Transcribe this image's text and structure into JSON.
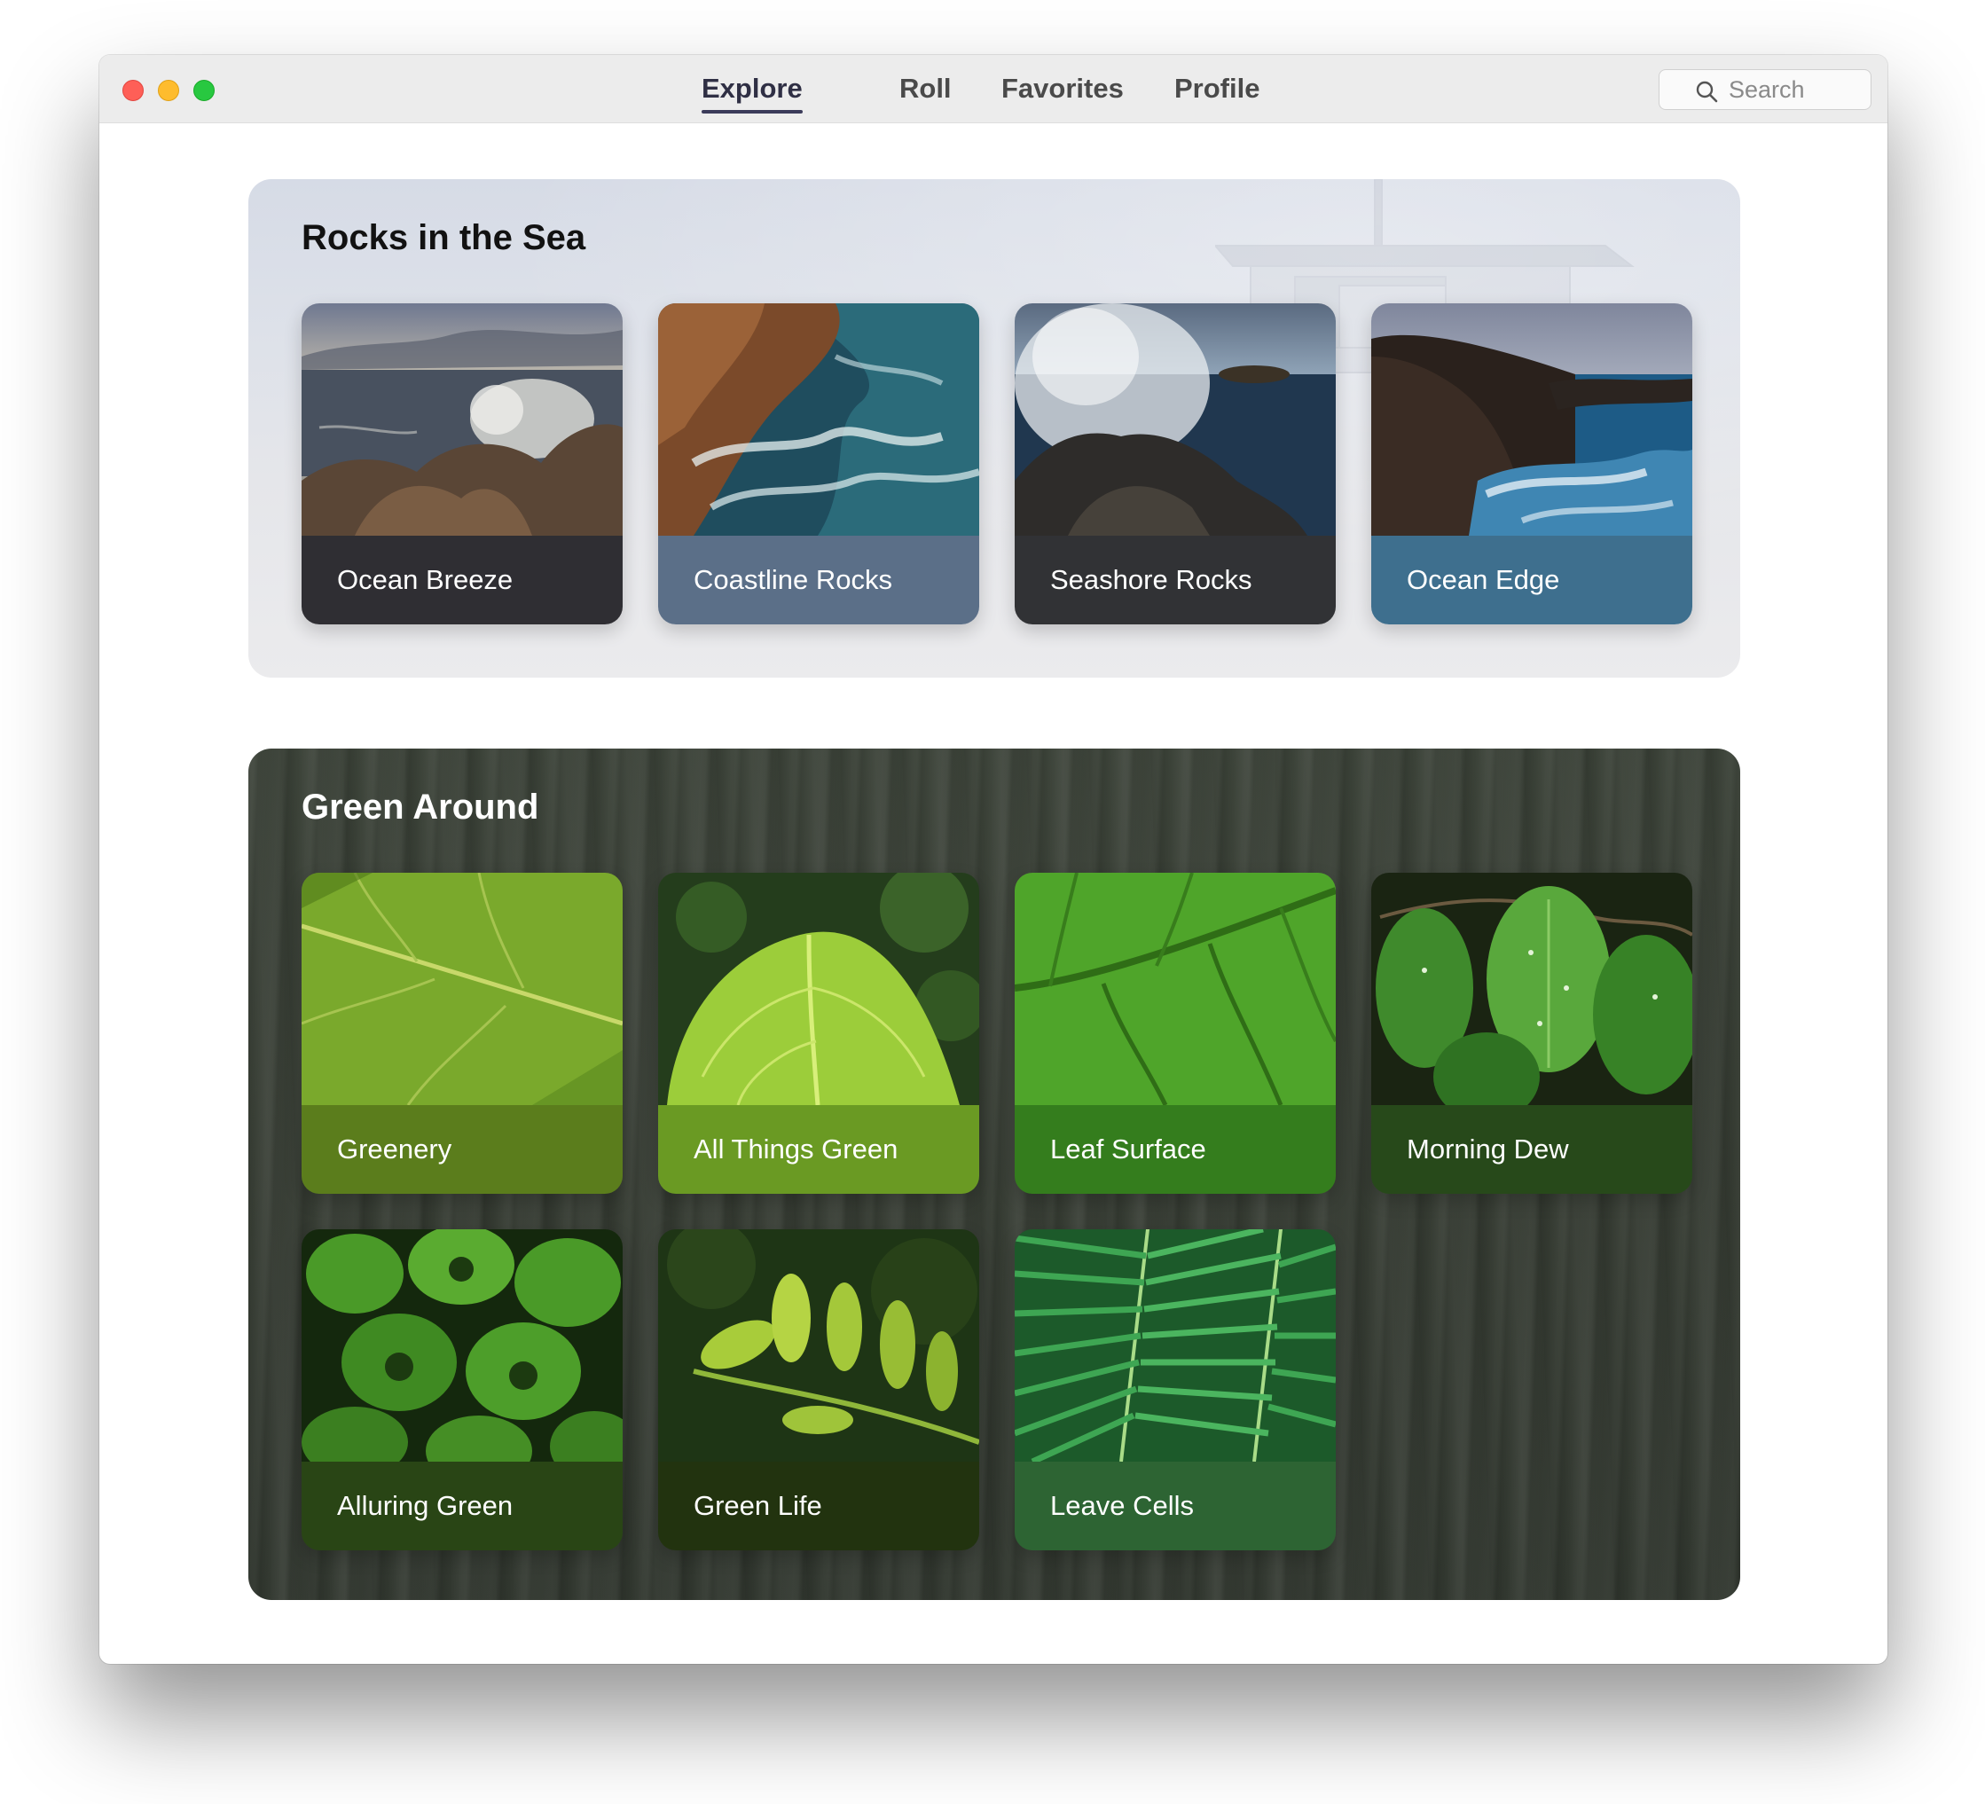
{
  "window": {
    "traffic_lights": [
      "close",
      "minimize",
      "zoom"
    ]
  },
  "nav": {
    "tabs": [
      {
        "label": "Explore",
        "active": true
      },
      {
        "label": "Roll",
        "active": false
      },
      {
        "label": "Favorites",
        "active": false
      },
      {
        "label": "Profile",
        "active": false
      }
    ],
    "search": {
      "placeholder": "Search",
      "icon": "search-icon"
    }
  },
  "sections": [
    {
      "title": "Rocks in the Sea",
      "cards": [
        {
          "label": "Ocean Breeze",
          "footer_color": "#2f2e33"
        },
        {
          "label": "Coastline Rocks",
          "footer_color": "#5b6f88"
        },
        {
          "label": "Seashore Rocks",
          "footer_color": "#313235"
        },
        {
          "label": "Ocean Edge",
          "footer_color": "#3e6f8e"
        }
      ]
    },
    {
      "title": "Green Around",
      "cards": [
        {
          "label": "Greenery",
          "footer_color": "#5b7d1c"
        },
        {
          "label": "All Things Green",
          "footer_color": "#6a9a23"
        },
        {
          "label": "Leaf Surface",
          "footer_color": "#347d1d"
        },
        {
          "label": "Morning Dew",
          "footer_color": "#27491a"
        },
        {
          "label": "Alluring Green",
          "footer_color": "#294515"
        },
        {
          "label": "Green Life",
          "footer_color": "#22330f"
        },
        {
          "label": "Leave Cells",
          "footer_color": "#2d6433"
        }
      ]
    }
  ]
}
